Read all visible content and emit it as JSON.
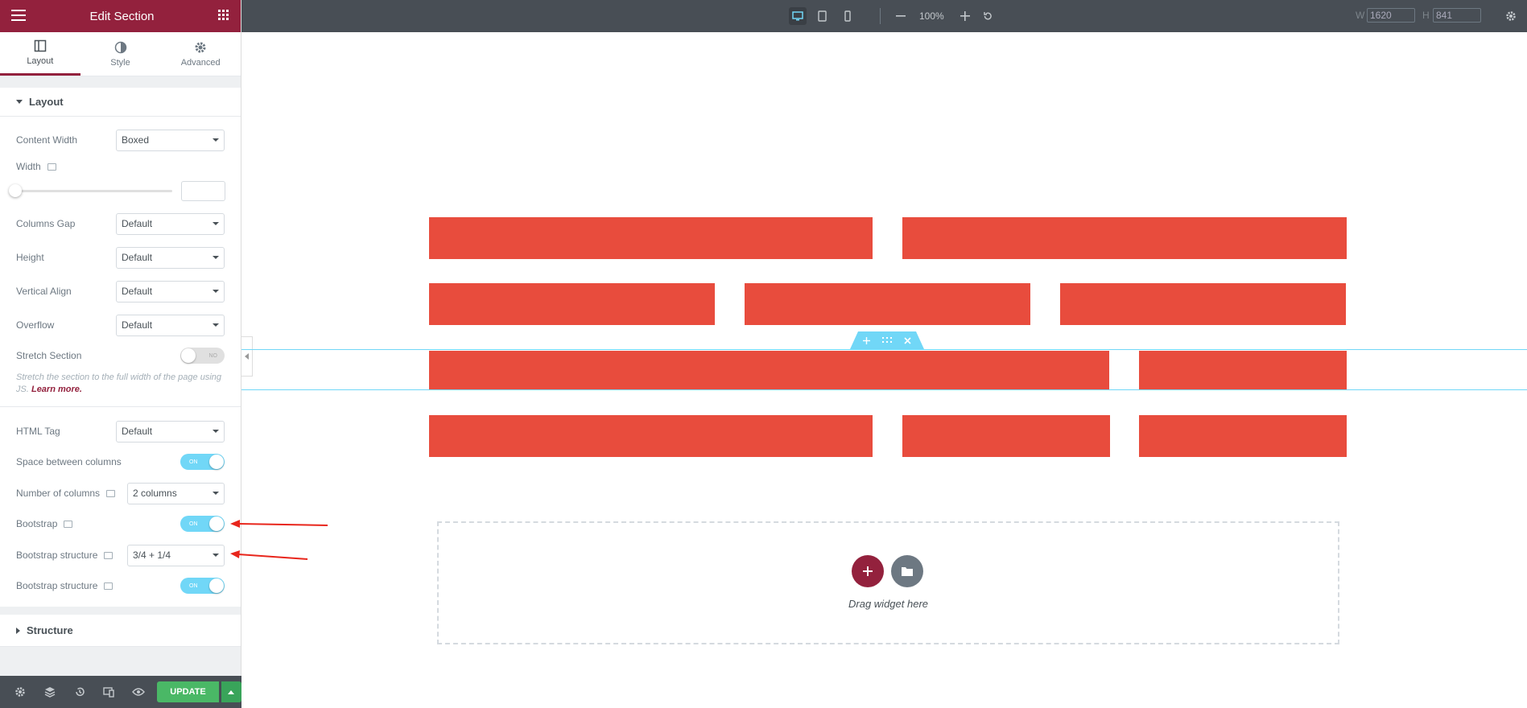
{
  "panel": {
    "title": "Edit Section",
    "tabs": [
      {
        "label": "Layout"
      },
      {
        "label": "Style"
      },
      {
        "label": "Advanced"
      }
    ],
    "section_layout": "Layout",
    "fields": {
      "content_width_label": "Content Width",
      "content_width": "Boxed",
      "width_label": "Width",
      "columns_gap_label": "Columns Gap",
      "columns_gap": "Default",
      "height_label": "Height",
      "height": "Default",
      "vertical_align_label": "Vertical Align",
      "vertical_align": "Default",
      "overflow_label": "Overflow",
      "overflow": "Default",
      "stretch_label": "Stretch Section",
      "stretch_toggle": "NO",
      "stretch_help": "Stretch the section to the full width of the page using JS.",
      "learn_more": "Learn more.",
      "html_tag_label": "HTML Tag",
      "html_tag": "Default",
      "space_between_label": "Space between columns",
      "space_between_toggle": "ON",
      "num_columns_label": "Number of columns",
      "num_columns": "2 columns",
      "bootstrap_label": "Bootstrap",
      "bootstrap_toggle": "ON",
      "bootstrap_structure_label": "Bootstrap structure",
      "bootstrap_structure": "3/4 + 1/4",
      "bootstrap_structure2_label": "Bootstrap structure",
      "bootstrap_structure2_toggle": "ON"
    },
    "section_structure": "Structure",
    "footer": {
      "update": "UPDATE"
    }
  },
  "topbar": {
    "zoom": "100%",
    "w_label": "W",
    "w_value": "1620",
    "h_label": "H",
    "h_value": "841"
  },
  "canvas": {
    "drag_text": "Drag widget here"
  },
  "colors": {
    "brand": "#93213d",
    "block": "#e84c3d",
    "accent": "#71d7f7",
    "update": "#4ab866"
  }
}
